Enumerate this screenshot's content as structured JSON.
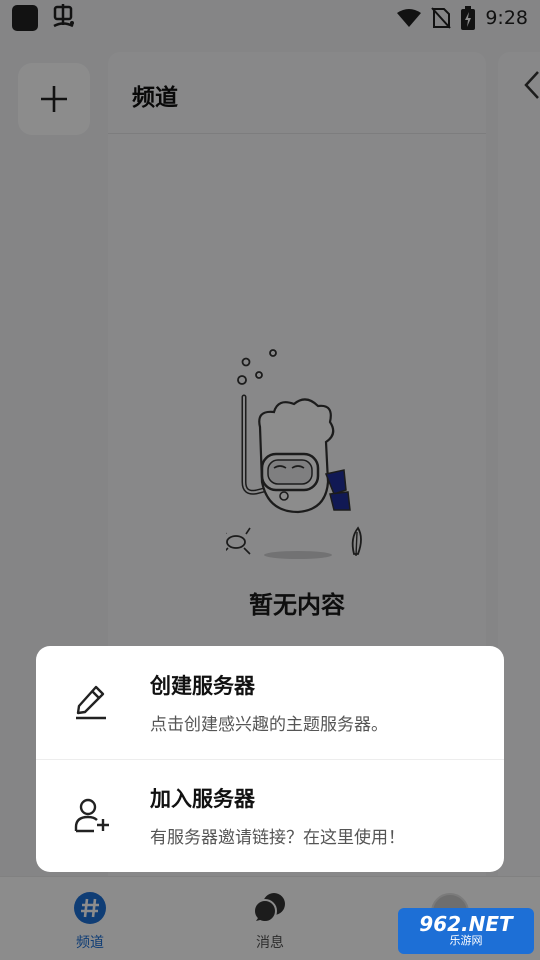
{
  "status_bar": {
    "time": "9:28",
    "icons": [
      "app-icon",
      "bug-icon",
      "wifi-icon",
      "no-sim-icon",
      "battery-charging-icon"
    ]
  },
  "channel_panel": {
    "title": "频道",
    "empty_text": "暂无内容"
  },
  "bottom_nav": {
    "items": [
      {
        "label": "频道",
        "icon": "hash-icon",
        "active": true
      },
      {
        "label": "消息",
        "icon": "chat-bubbles-icon",
        "active": false
      },
      {
        "label": "",
        "icon": "avatar",
        "active": false
      }
    ]
  },
  "popup": {
    "items": [
      {
        "title": "创建服务器",
        "description": "点击创建感兴趣的主题服务器。",
        "icon": "pencil-icon"
      },
      {
        "title": "加入服务器",
        "description": "有服务器邀请链接？在这里使用！",
        "icon": "add-user-icon"
      }
    ]
  },
  "watermark": {
    "main_text": "962.NET",
    "sub_text": "乐游网"
  },
  "colors": {
    "accent": "#1d6fd6",
    "overlay": "rgba(0,0,0,0.45)",
    "panel": "#f8f8f9"
  }
}
